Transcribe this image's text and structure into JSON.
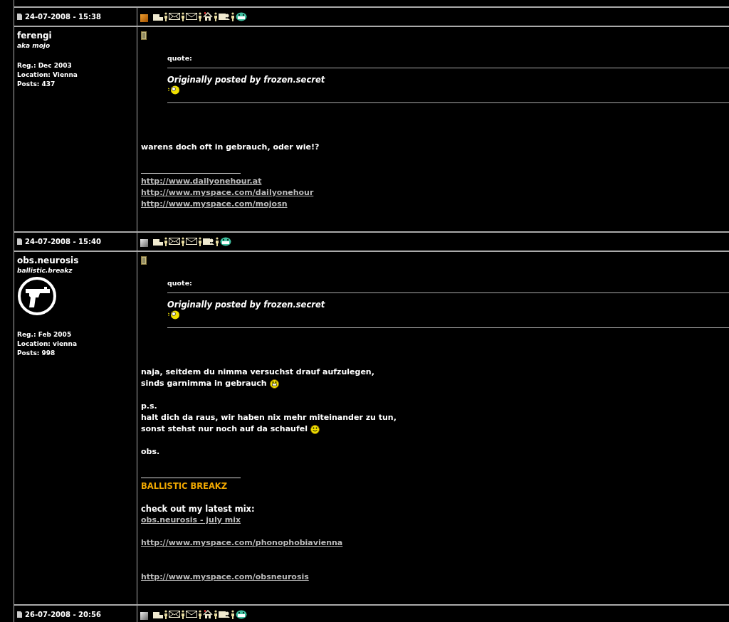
{
  "posts": [
    {
      "date": "24-07-2008 - 15:38",
      "online": true,
      "header_icons": [
        {
          "kind": "profile"
        },
        {
          "kind": "mail"
        },
        {
          "kind": "email"
        },
        {
          "kind": "homepage"
        },
        {
          "kind": "card"
        },
        {
          "kind": "grin"
        }
      ],
      "author": "ferengi",
      "subtitle": "aka mojo",
      "avatar": false,
      "reg": "Reg.: Dec 2003",
      "location": "Location: Vienna",
      "posts": "Posts: 437",
      "quote": {
        "label": "quote:",
        "attribution": "Originally posted by frozen.secret"
      },
      "message": [
        [
          {
            "text": "warens doch oft in gebrauch, oder wie!?"
          }
        ]
      ],
      "signature": [
        {
          "kind": "link",
          "text": "http://www.dailyonehour.at"
        },
        {
          "kind": "link",
          "text": "http://www.myspace.com/dailyonehour"
        },
        {
          "kind": "link",
          "text": "http://www.myspace.com/mojosn"
        }
      ]
    },
    {
      "date": "24-07-2008 - 15:40",
      "online": false,
      "header_icons": [
        {
          "kind": "profile"
        },
        {
          "kind": "mail"
        },
        {
          "kind": "email"
        },
        {
          "kind": "card"
        },
        {
          "kind": "grin"
        }
      ],
      "author": "obs.neurosis",
      "subtitle": "ballistic.breakz",
      "avatar": true,
      "reg": "Reg.: Feb 2005",
      "location": "Location: vienna",
      "posts": "Posts: 998",
      "quote": {
        "label": "quote:",
        "attribution": "Originally posted by frozen.secret"
      },
      "message": [
        [
          {
            "text": "naja, seitdem du nimma versuchst drauf aufzulegen,"
          },
          {
            "text": "sinds garnimma in gebrauch",
            "smiley": {
              "kind": "grin"
            }
          }
        ],
        [
          {
            "text": "p.s."
          },
          {
            "text": "halt dich da raus, wir haben nix mehr miteinander zu tun,"
          },
          {
            "text": "sonst stehst nur noch auf da schaufel",
            "smiley": {
              "kind": "smile"
            }
          }
        ],
        [
          {
            "text": "obs."
          }
        ]
      ],
      "signature": [
        {
          "kind": "brand",
          "text": "BALLISTIC BREAKZ"
        },
        {
          "kind": "heading",
          "text": "check out my latest mix:"
        },
        {
          "kind": "link",
          "text": "obs.neurosis - july mix"
        },
        {
          "kind": "link-gap",
          "text": "http://www.myspace.com/phonophobiavienna"
        },
        {
          "kind": "link-far",
          "text": "http://www.myspace.com/obsneurosis"
        }
      ]
    },
    {
      "date": "26-07-2008 - 20:56",
      "online": false,
      "header_icons": [
        {
          "kind": "profile"
        },
        {
          "kind": "mail"
        },
        {
          "kind": "email"
        },
        {
          "kind": "homepage"
        },
        {
          "kind": "card"
        },
        {
          "kind": "grin"
        }
      ]
    }
  ]
}
